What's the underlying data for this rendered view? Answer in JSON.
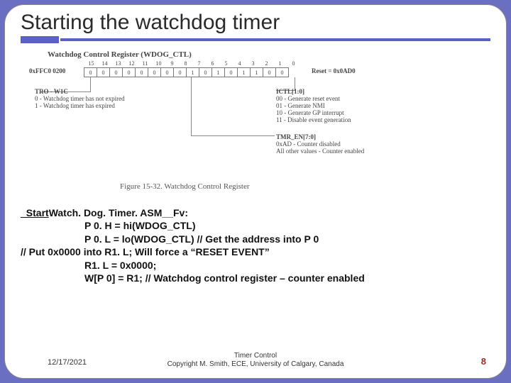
{
  "title": "Starting the watchdog timer",
  "diagram": {
    "reg_title": "Watchdog Control Register (WDOG_CTL)",
    "address": "0xFFC0 0200",
    "bitnums": [
      "15",
      "14",
      "13",
      "12",
      "11",
      "10",
      "9",
      "8",
      "7",
      "6",
      "5",
      "4",
      "3",
      "2",
      "1",
      "0"
    ],
    "bitvals": [
      "0",
      "0",
      "0",
      "0",
      "0",
      "0",
      "0",
      "0",
      "1",
      "0",
      "1",
      "0",
      "1",
      "1",
      "0",
      "0"
    ],
    "reset": "Reset = 0x0AD0",
    "tro_head": "TRO - W1C",
    "tro_l1": "0 - Watchdog timer has not expired",
    "tro_l2": "1 - Watchdog timer has expired",
    "ictl_head": "ICTL[1:0]",
    "ictl_l1": "00 - Generate reset event",
    "ictl_l2": "01 - Generate NMI",
    "ictl_l3": "10 - Generate GP interrupt",
    "ictl_l4": "11 - Disable event generation",
    "tmr_head": "TMR_EN[7:0]",
    "tmr_l1": "0xAD - Counter disabled",
    "tmr_l2": "All other values - Counter enabled",
    "caption": "Figure 15-32. Watchdog Control Register"
  },
  "code": {
    "line1_prefix": "_Start",
    "line1_rest": "Watch. Dog. Timer. ASM__Fv:",
    "line2": "P 0. H = hi(WDOG_CTL)",
    "line3": "P 0. L = lo(WDOG_CTL)   // Get the address into P 0",
    "line4": "// Put 0x0000 into R1. L;  Will force a “RESET EVENT”",
    "line5": "R1. L = 0x0000;",
    "line6": "W[P 0] = R1;   // Watchdog control register – counter enabled"
  },
  "footer": {
    "date": "12/17/2021",
    "mid_l1": "Timer Control",
    "mid_l2": "Copyright M. Smith, ECE, University of Calgary, Canada",
    "page": "8"
  }
}
